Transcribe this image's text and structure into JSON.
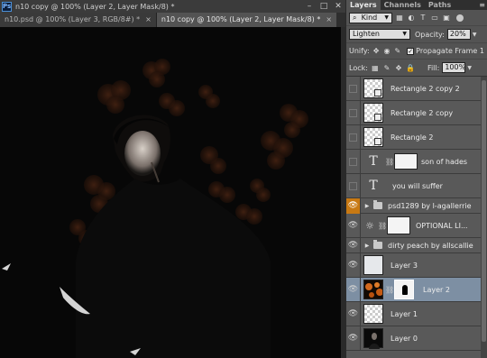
{
  "app": {
    "logo_text": "Ps"
  },
  "window": {
    "title": "n10 copy @ 100% (Layer 2, Layer Mask/8) *",
    "controls": [
      "–",
      "□",
      "✕"
    ]
  },
  "doc_tabs": [
    {
      "label": "n10.psd @ 100% (Layer 3, RGB/8#) *",
      "active": false
    },
    {
      "label": "n10 copy @ 100% (Layer 2, Layer Mask/8) *",
      "active": true
    }
  ],
  "panel": {
    "tabs": [
      "Layers",
      "Channels",
      "Paths"
    ],
    "menu_icon": "≡",
    "filter": {
      "kind_label": "Kind"
    },
    "blend_mode": "Lighten",
    "opacity_label": "Opacity:",
    "opacity_value": "20%",
    "unify_label": "Unify:",
    "propagate_label": "Propagate Frame 1",
    "lock_label": "Lock:",
    "fill_label": "Fill:",
    "fill_value": "100%"
  },
  "layers": [
    {
      "name": "Rectangle 2 copy 2",
      "type": "shape",
      "visible": false
    },
    {
      "name": "Rectangle 2 copy",
      "type": "shape",
      "visible": false
    },
    {
      "name": "Rectangle 2",
      "type": "shape",
      "visible": false
    },
    {
      "name": "son of hades",
      "type": "text-masked",
      "visible": false
    },
    {
      "name": "you will suffer",
      "type": "text",
      "visible": false
    },
    {
      "name": "psd1289 by l-agallerrie",
      "type": "folder",
      "visible": true
    },
    {
      "name": "OPTIONAL LI...",
      "type": "adjustment",
      "visible": true
    },
    {
      "name": "dirty peach by allscallie",
      "type": "folder",
      "visible": true
    },
    {
      "name": "Layer 3",
      "type": "pixel-light",
      "visible": true
    },
    {
      "name": "Layer 2",
      "type": "pixel-masked",
      "visible": true,
      "selected": true
    },
    {
      "name": "Layer 1",
      "type": "pixel-empty",
      "visible": true
    },
    {
      "name": "Layer 0",
      "type": "pixel-dark",
      "visible": true
    }
  ]
}
